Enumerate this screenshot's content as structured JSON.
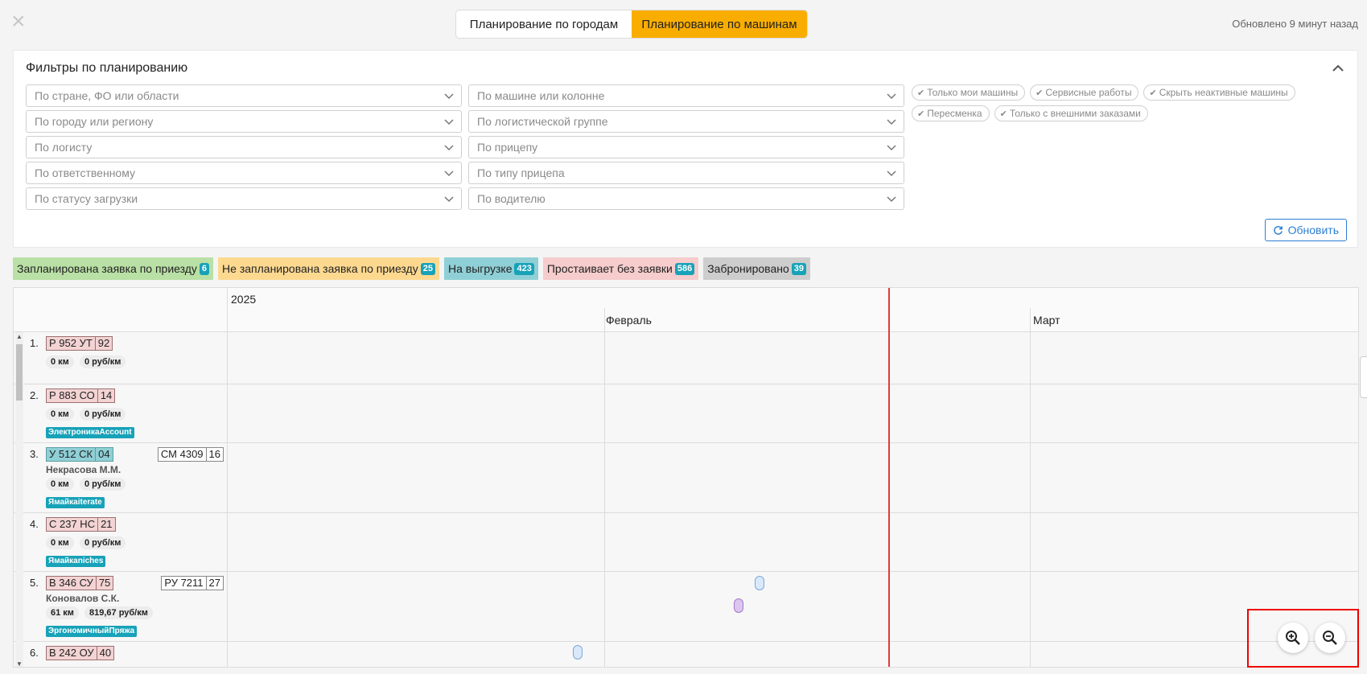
{
  "header": {
    "close_icon": "close-icon",
    "tabs": [
      {
        "label": "Планирование по городам",
        "active": false
      },
      {
        "label": "Планирование по машинам",
        "active": true
      }
    ],
    "updated": "Обновлено 9 минут назад"
  },
  "filters": {
    "title": "Фильтры по планированию",
    "left": [
      "По стране, ФО или области",
      "По городу или региону",
      "По логисту",
      "По ответственному",
      "По статусу загрузки"
    ],
    "right": [
      "По машине или колонне",
      "По логистической группе",
      "По прицепу",
      "По типу прицепа",
      "По водителю"
    ],
    "chips": [
      "Только мои машины",
      "Сервисные работы",
      "Скрыть неактивные машины",
      "Пересменка",
      "Только с внешними заказами"
    ],
    "refresh_label": "Обновить"
  },
  "legend": [
    {
      "label": "Запланирована заявка по приезду",
      "count": "6",
      "color": "#b9e0a5"
    },
    {
      "label": "Не запланирована заявка по приезду",
      "count": "25",
      "color": "#fdd990"
    },
    {
      "label": "На выгрузке",
      "count": "423",
      "color": "#8fd0d6"
    },
    {
      "label": "Простаивает без заявки",
      "count": "586",
      "color": "#f6cccc"
    },
    {
      "label": "Забронировано",
      "count": "39",
      "color": "#cdcdcd"
    }
  ],
  "timeline": {
    "year": "2025",
    "months": [
      "Февраль",
      "Март"
    ]
  },
  "rows": [
    {
      "num": "1.",
      "plate": "Р 952 УТ",
      "region": "92",
      "km": "0 км",
      "rate": "0 руб/км"
    },
    {
      "num": "2.",
      "plate": "Р 883 СО",
      "region": "14",
      "km": "0 км",
      "rate": "0 руб/км",
      "tag": "ЭлектроникаAccount"
    },
    {
      "num": "3.",
      "plate": "У 512 СК",
      "region": "04",
      "trailer": "СМ 4309",
      "trailer_region": "16",
      "driver": "Некрасова М.М.",
      "km": "0 км",
      "rate": "0 руб/км",
      "tag": "Ямайкаiterate"
    },
    {
      "num": "4.",
      "plate": "С 237 НС",
      "region": "21",
      "km": "0 км",
      "rate": "0 руб/км",
      "tag": "Ямайкаniches"
    },
    {
      "num": "5.",
      "plate": "В 346 СУ",
      "region": "75",
      "trailer": "РУ 7211",
      "trailer_region": "27",
      "driver": "Коновалов С.К.",
      "km": "61 км",
      "rate": "819,67 руб/км",
      "tag": "ЭргономичныйПряжа"
    },
    {
      "num": "6.",
      "plate": "В 242 ОУ",
      "region": "40"
    }
  ],
  "zoom": {
    "in_icon": "zoom-in-icon",
    "out_icon": "zoom-out-icon"
  }
}
